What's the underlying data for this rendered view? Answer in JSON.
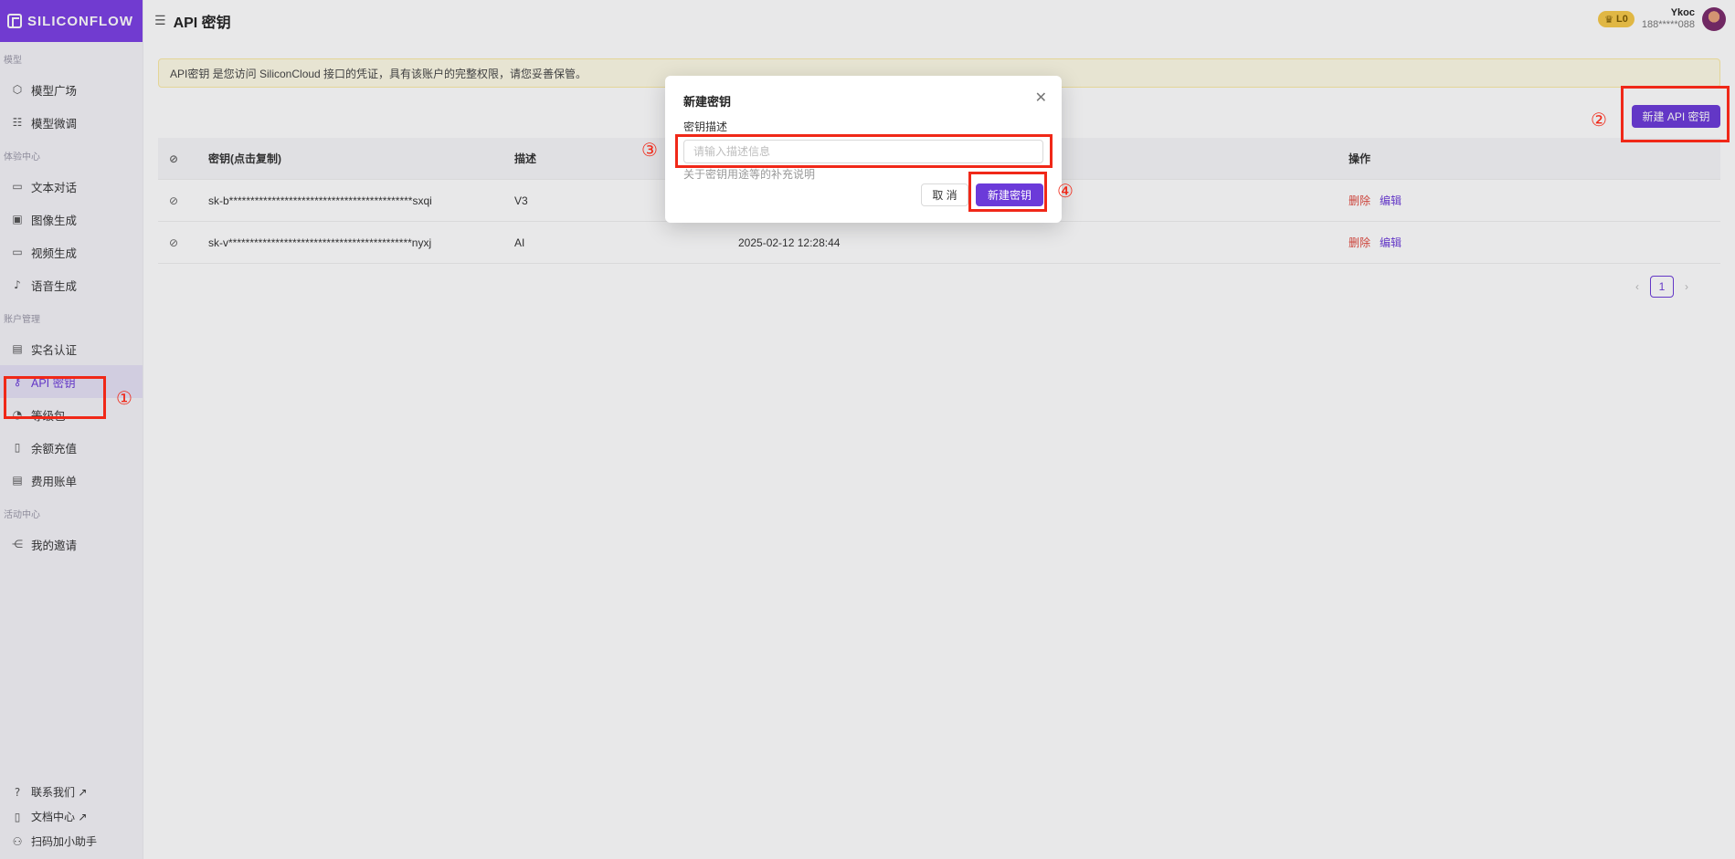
{
  "brand": {
    "name": "SILICONFLOW"
  },
  "header": {
    "menu_icon": "☰",
    "title": "API 密钥",
    "level": "L0",
    "user_name": "Ykoc",
    "user_phone": "188*****088"
  },
  "sidebar": {
    "sections": [
      {
        "label": "模型",
        "items": [
          {
            "label": "模型广场",
            "icon": "cube-icon"
          },
          {
            "label": "模型微调",
            "icon": "sliders-icon"
          }
        ]
      },
      {
        "label": "体验中心",
        "items": [
          {
            "label": "文本对话",
            "icon": "chat-icon"
          },
          {
            "label": "图像生成",
            "icon": "image-icon"
          },
          {
            "label": "视频生成",
            "icon": "video-icon"
          },
          {
            "label": "语音生成",
            "icon": "mic-icon"
          }
        ]
      },
      {
        "label": "账户管理",
        "items": [
          {
            "label": "实名认证",
            "icon": "id-card-icon"
          },
          {
            "label": "API 密钥",
            "icon": "key-icon",
            "active": true
          },
          {
            "label": "等级包",
            "icon": "gift-icon"
          },
          {
            "label": "余额充值",
            "icon": "wallet-icon"
          },
          {
            "label": "费用账单",
            "icon": "bill-icon"
          }
        ]
      },
      {
        "label": "活动中心",
        "items": [
          {
            "label": "我的邀请",
            "icon": "share-icon"
          }
        ]
      }
    ],
    "bottom": [
      {
        "label": "联系我们 ↗",
        "icon": "help-icon"
      },
      {
        "label": "文档中心 ↗",
        "icon": "doc-icon"
      },
      {
        "label": "扫码加小助手",
        "icon": "people-icon"
      }
    ]
  },
  "notice": "API密钥 是您访问 SiliconCloud 接口的凭证，具有该账户的完整权限，请您妥善保管。",
  "new_key_button": "新建 API 密钥",
  "table": {
    "headers": {
      "key": "密钥(点击复制)",
      "desc": "描述",
      "ops": "操作"
    },
    "rows": [
      {
        "key": "sk-b*******************************************sxqi",
        "desc": "V3",
        "time": "",
        "delete": "删除",
        "edit": "编辑"
      },
      {
        "key": "sk-v*******************************************nyxj",
        "desc": "AI",
        "time": "2025-02-12 12:28:44",
        "delete": "删除",
        "edit": "编辑"
      }
    ]
  },
  "pagination": {
    "current": "1",
    "prev": "‹",
    "next": "›"
  },
  "modal": {
    "title": "新建密钥",
    "field_label": "密钥描述",
    "placeholder": "请输入描述信息",
    "help": "关于密钥用途等的补充说明",
    "cancel": "取 消",
    "submit": "新建密钥"
  },
  "annotations": [
    "①",
    "②",
    "③",
    "④"
  ],
  "colors": {
    "accent": "#6b3ad9",
    "danger": "#e0483d",
    "annotation": "#f02818"
  }
}
